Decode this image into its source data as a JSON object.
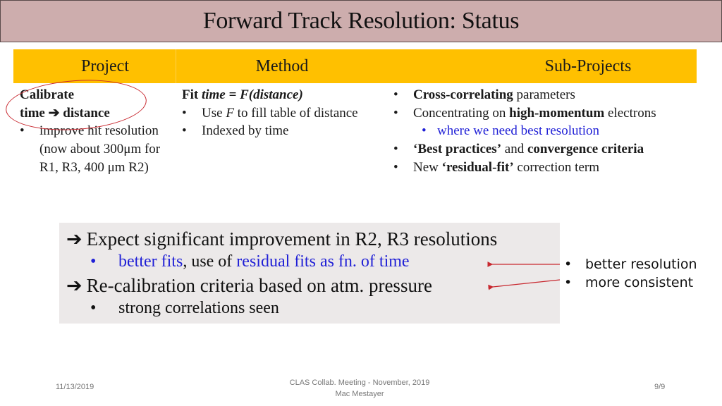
{
  "slide": {
    "title": "Forward Track Resolution: Status"
  },
  "table": {
    "headers": [
      "Project",
      "Method",
      "Sub-Projects"
    ],
    "project": {
      "line1": "Calibrate",
      "line2_a": "time ",
      "line2_arrow": "➔",
      "line2_b": " distance",
      "bullet": "•",
      "bullet_text": "improve hit resolution (now about 300μm for R1, R3, 400 μm R2)"
    },
    "method": {
      "fit_prefix": "Fit ",
      "fit_formula": "time = F(distance)",
      "bullets": [
        {
          "pre": "Use ",
          "italic": "F",
          "post": " to fill table of distance"
        },
        {
          "pre": "Indexed by time",
          "italic": "",
          "post": ""
        }
      ]
    },
    "subprojects": {
      "items": [
        {
          "bold": "Cross-correlating",
          "text": " parameters"
        },
        {
          "text": "Concentrating on ",
          "bold": "high-momentum",
          "tail": " electrons"
        },
        {
          "sub": "where we need best resolution"
        },
        {
          "bold": "‘Best practices’",
          "text": " and ",
          "bold2": "convergence criteria"
        },
        {
          "text": "New ",
          "bold": "‘residual-fit’",
          "tail": " correction term"
        }
      ],
      "sub_color": "#1f1fd6"
    }
  },
  "callout": {
    "line1": "Expect significant improvement in  R2, R3 resolutions",
    "line2_blue_a": "better fits",
    "line2_black": ", use of ",
    "line2_blue_b": "residual fits as fn. of time",
    "line3": "Re-calibration criteria based on atm. pressure",
    "line4": "strong correlations seen",
    "arrow": "➔",
    "bullet": "•"
  },
  "side_notes": [
    "better resolution",
    "more consistent"
  ],
  "footer": {
    "date": "11/13/2019",
    "center_line1": "CLAS Collab. Meeting - November, 2019",
    "center_line2": "Mac Mestayer",
    "page": "9/9"
  },
  "colors": {
    "title_bg": "#cdadad",
    "header_bg": "#ffc000",
    "callout_bg": "#ece9e9",
    "accent_red": "#c8282f",
    "link_blue": "#1f1fd6"
  }
}
